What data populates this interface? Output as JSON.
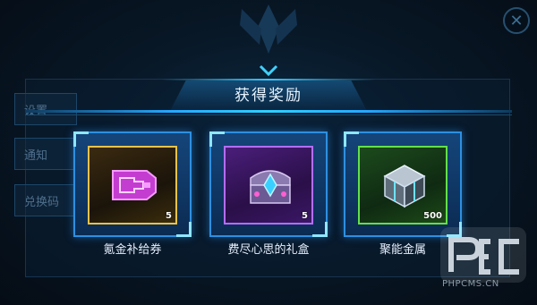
{
  "dialog": {
    "title": "获得奖励"
  },
  "rewards": [
    {
      "name": "氪金补给券",
      "quantity": "5",
      "rarity_color": "#e8c24a",
      "icon": "coupon-icon"
    },
    {
      "name": "费尽心思的礼盒",
      "quantity": "5",
      "rarity_color": "#b36dff",
      "icon": "treasure-chest-icon"
    },
    {
      "name": "聚能金属",
      "quantity": "500",
      "rarity_color": "#63e04a",
      "icon": "metal-cube-icon"
    }
  ],
  "background": {
    "menu": [
      "设置",
      "通知",
      "兑换码"
    ],
    "exchange": "兑换",
    "top_left": "",
    "top_right": ""
  },
  "watermark": {
    "text": "PHPCMS.CN"
  },
  "theme": {
    "accent": "#2fd1ff",
    "frame": "#2e8fe0",
    "background": "#07111c"
  }
}
